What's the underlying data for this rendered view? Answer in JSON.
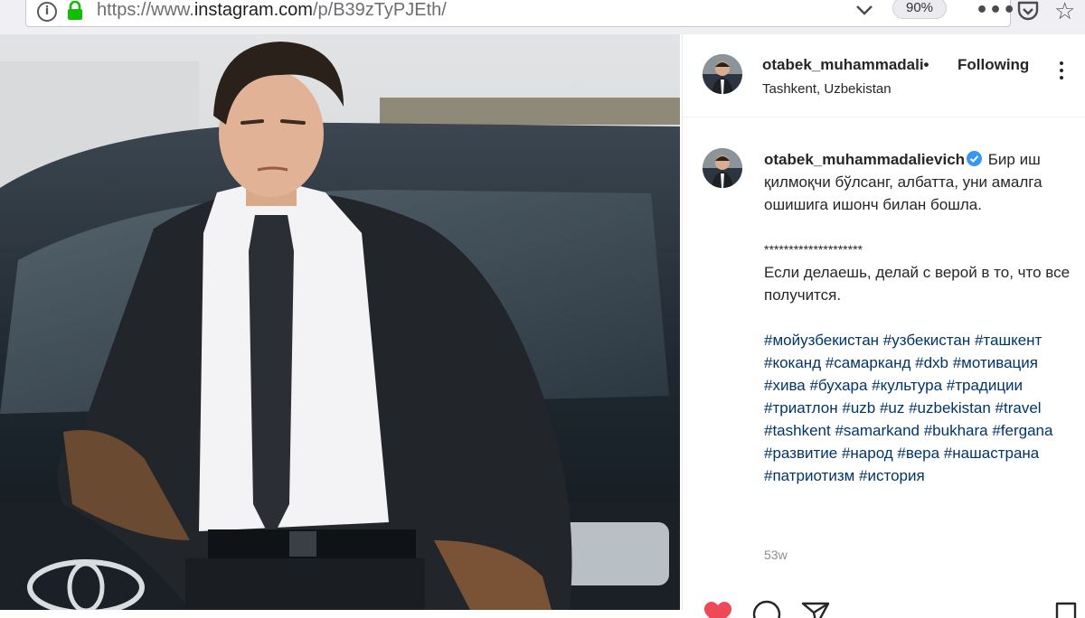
{
  "browser": {
    "url_prefix": "https://www.",
    "url_host": "instagram.com",
    "url_path": "/p/B39zTyPJEth/",
    "zoom": "90%",
    "icons": [
      "info-icon",
      "lock-icon",
      "chevron-down-icon",
      "more-dots-icon",
      "pocket-icon",
      "star-icon"
    ]
  },
  "post": {
    "header": {
      "username": "otabek_muhammadali•",
      "separator": "•",
      "follow_label": "Following",
      "location": "Tashkent, Uzbekistan"
    },
    "caption": {
      "username": "otabek_muhammadalievich",
      "text_uz": "Бир иш қилмоқчи бўлсанг, албатта, уни амалга ошишига ишонч билан бошла.",
      "divider": "********************",
      "text_ru": "Если делаешь, делай с верой в то, что все получится.",
      "hashtags": "#мойузбекистан #узбекистан #ташкент #коканд #самарканд #dxb #мотивация #хива #бухара #культура #традиции #триатлон #uzb #uz #uzbekistan #travel #tashkent #samarkand #bukhara #fergana #развитие #народ #вера #нашастрана #патриотизм #история",
      "time": "53w"
    },
    "actions": [
      "heart-icon",
      "comment-icon",
      "share-icon",
      "save-icon"
    ],
    "colors": {
      "like": "#ed4956",
      "hashtag": "#003569",
      "verified": "#3897f0"
    }
  }
}
